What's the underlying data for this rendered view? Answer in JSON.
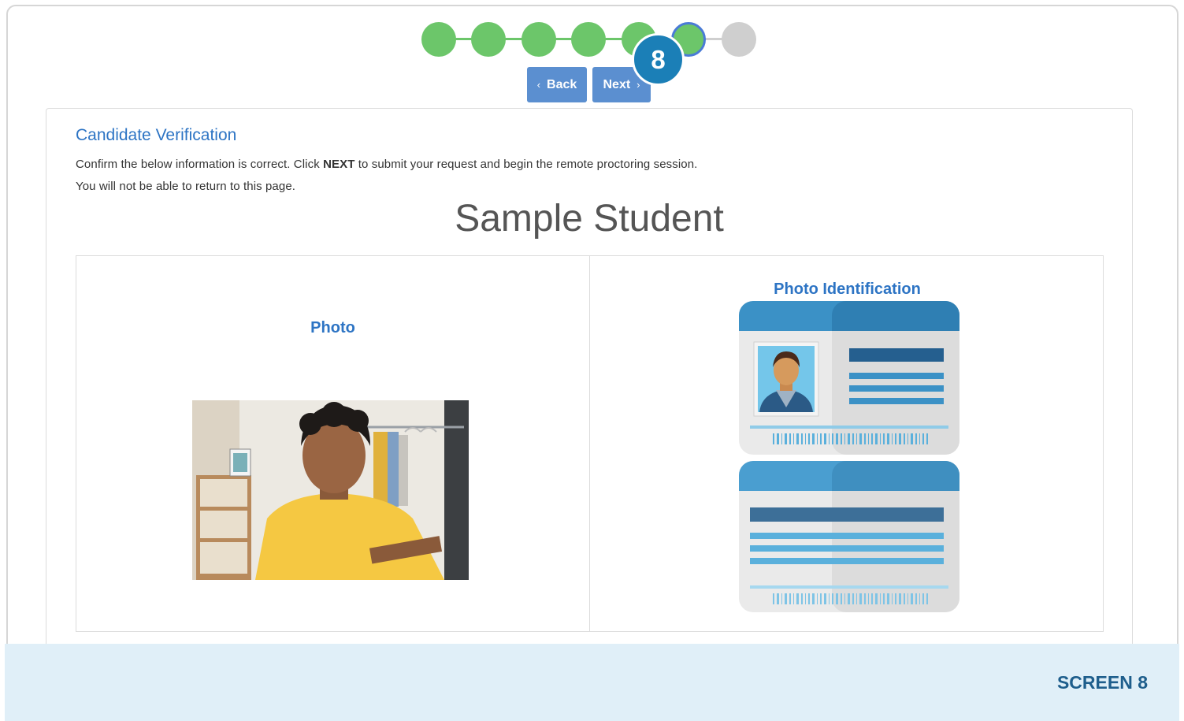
{
  "stepper": {
    "steps": [
      "done",
      "done",
      "done",
      "done",
      "done",
      "current",
      "todo"
    ],
    "current_step_badge": "8"
  },
  "nav": {
    "back_label": "Back",
    "next_label": "Next"
  },
  "verification": {
    "title": "Candidate Verification",
    "instruction_prefix": "Confirm the below information is correct. Click ",
    "instruction_bold": "NEXT",
    "instruction_suffix": " to submit your request and begin the remote proctoring session.",
    "instruction_line2": "You will not be able to return to this page.",
    "student_name": "Sample Student",
    "photo_heading": "Photo",
    "id_heading": "Photo Identification"
  },
  "footer": {
    "screen_label": "SCREEN 8"
  },
  "colors": {
    "step_done": "#6cc66a",
    "step_todo": "#cfcfcf",
    "step_current_border": "#4a7bd6",
    "badge": "#1b7fb7",
    "button": "#5b8fd0",
    "heading_blue": "#2d74c4",
    "footer_bg": "#e0eff8"
  }
}
